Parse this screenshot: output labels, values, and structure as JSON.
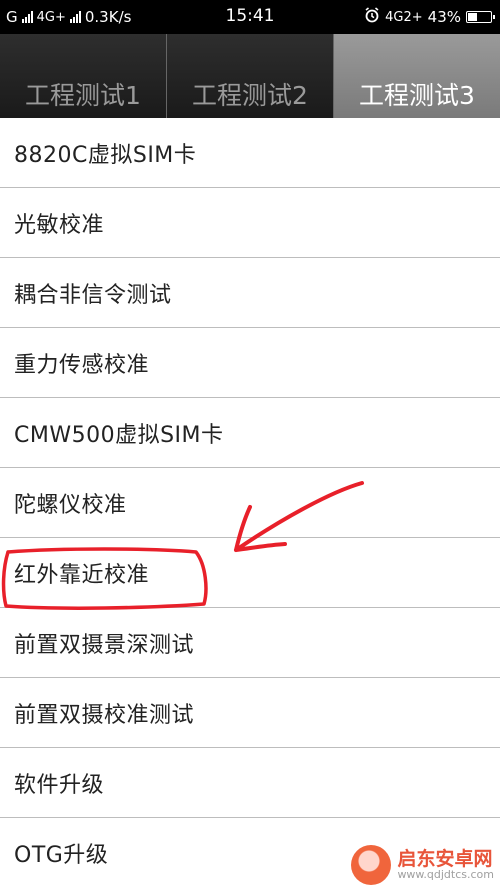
{
  "status_bar": {
    "carrier": "G",
    "network1": "4G+",
    "speed": "0.3K/s",
    "time": "15:41",
    "network2": "4G2+",
    "battery_percent": "43%",
    "battery_level": 0.43
  },
  "tabs": [
    {
      "label": "工程测试1",
      "active": false
    },
    {
      "label": "工程测试2",
      "active": false
    },
    {
      "label": "工程测试3",
      "active": true
    }
  ],
  "items": [
    {
      "label": "8820C虚拟SIM卡"
    },
    {
      "label": "光敏校准"
    },
    {
      "label": "耦合非信令测试"
    },
    {
      "label": "重力传感校准"
    },
    {
      "label": "CMW500虚拟SIM卡"
    },
    {
      "label": "陀螺仪校准"
    },
    {
      "label": "红外靠近校准"
    },
    {
      "label": "前置双摄景深测试"
    },
    {
      "label": "前置双摄校准测试"
    },
    {
      "label": "软件升级"
    },
    {
      "label": "OTG升级"
    }
  ],
  "annotation": {
    "color": "#e8202a"
  },
  "watermark": {
    "name": "启东安卓网",
    "url": "www.qdjdtcs.com"
  }
}
